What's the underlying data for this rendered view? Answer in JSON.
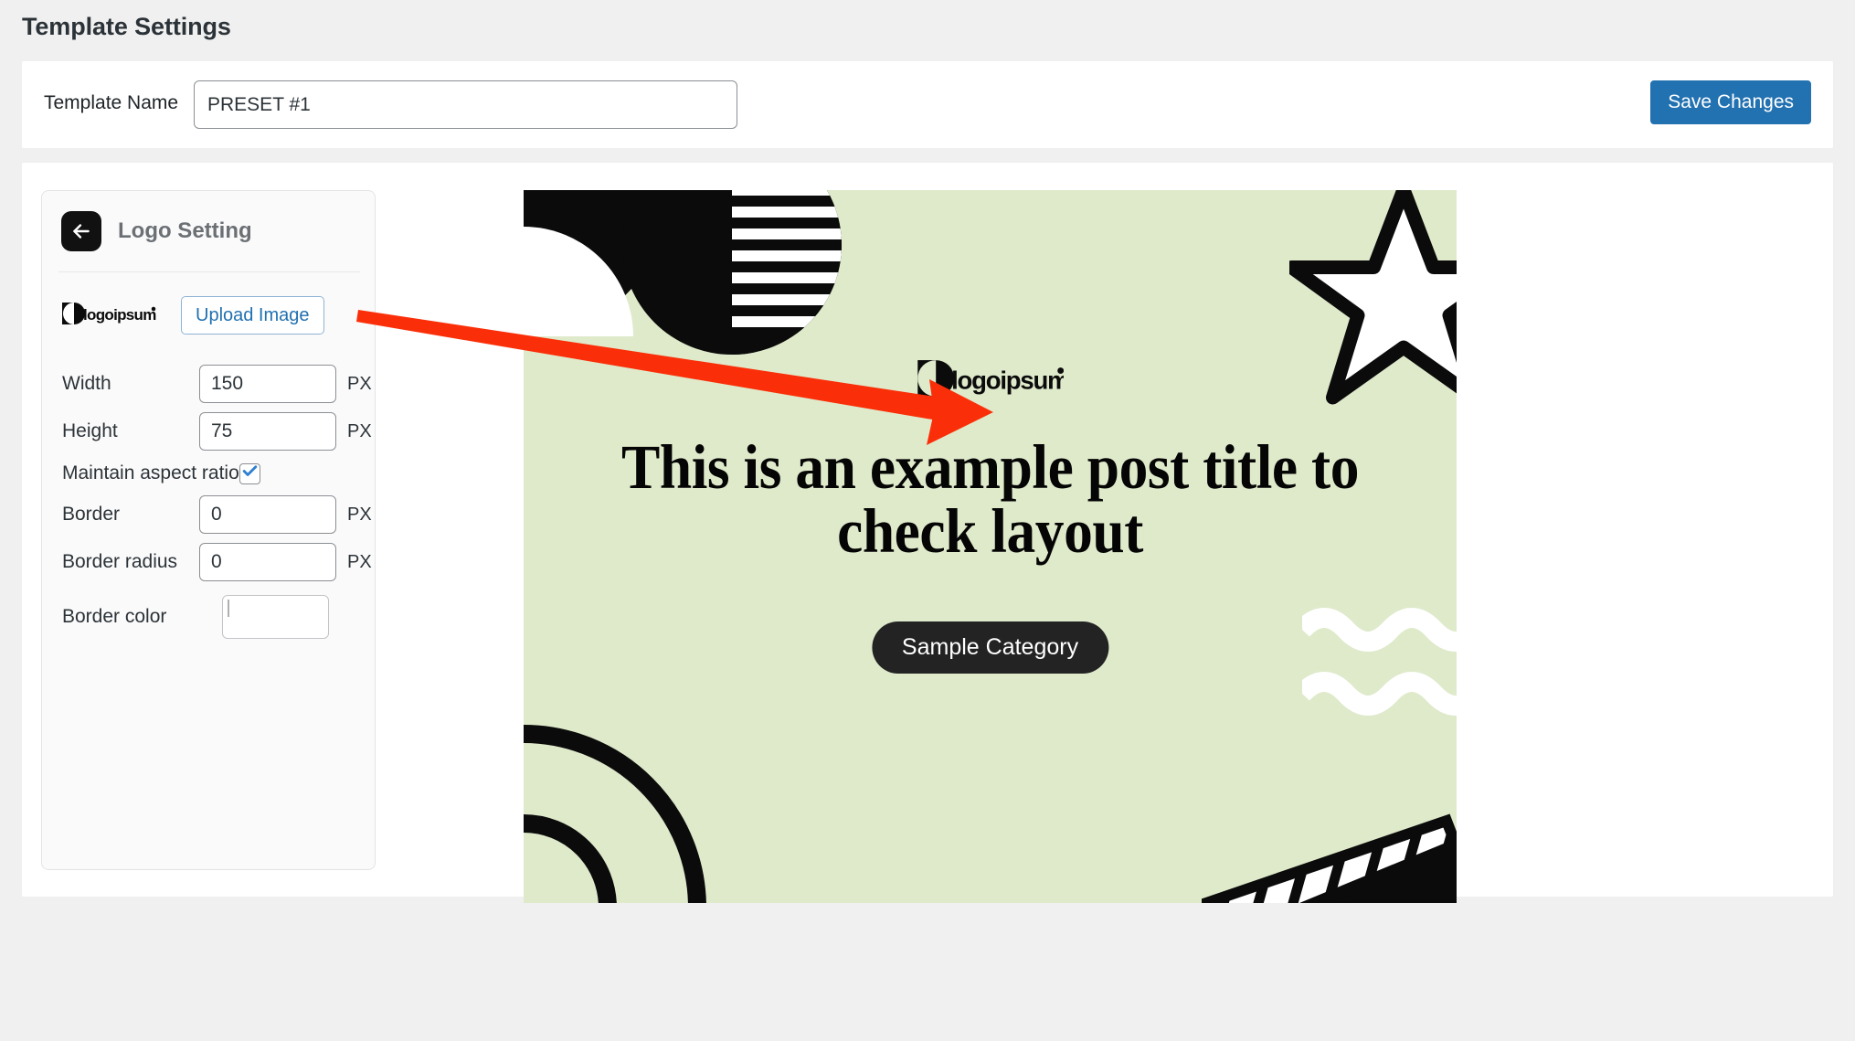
{
  "page": {
    "title": "Template Settings",
    "background_color": "#f0f0f0"
  },
  "template_bar": {
    "label": "Template Name",
    "value": "PRESET #1",
    "placeholder": "Template Name",
    "save_label": "Save Changes",
    "accent_color": "#2271b1"
  },
  "logo_setting": {
    "back_icon": "arrow-left-icon",
    "title": "Logo Setting",
    "logo_alt": "logoipsum",
    "upload_label": "Upload Image",
    "fields": [
      {
        "label": "Width",
        "value": "150",
        "unit": "PX"
      },
      {
        "label": "Height",
        "value": "75",
        "unit": "PX"
      },
      {
        "label": "Border",
        "value": "0",
        "unit": "PX"
      },
      {
        "label": "Border radius",
        "value": "0",
        "unit": "PX"
      }
    ],
    "aspect_ratio": {
      "label": "Maintain aspect ratio",
      "checked": true,
      "check_color": "#2f7fd1"
    },
    "border_color": {
      "label": "Border color",
      "value": "#000000"
    }
  },
  "preview": {
    "background_color": "#dfeacb",
    "logo_alt": "logoipsum",
    "post_title": "This is an example post title to check layout",
    "category": "Sample Category",
    "category_bg": "#232323",
    "shapes": [
      "quarter-circle-top-left",
      "half-circle-black",
      "half-circle-striped",
      "star-outline-top-right",
      "concentric-arcs-bottom-left",
      "wave-lines-bottom-right",
      "striped-bar-bottom-right"
    ]
  },
  "annotation": {
    "arrow_color": "#fa2f09",
    "from": "upload-image-button",
    "to": "preview-logo"
  }
}
